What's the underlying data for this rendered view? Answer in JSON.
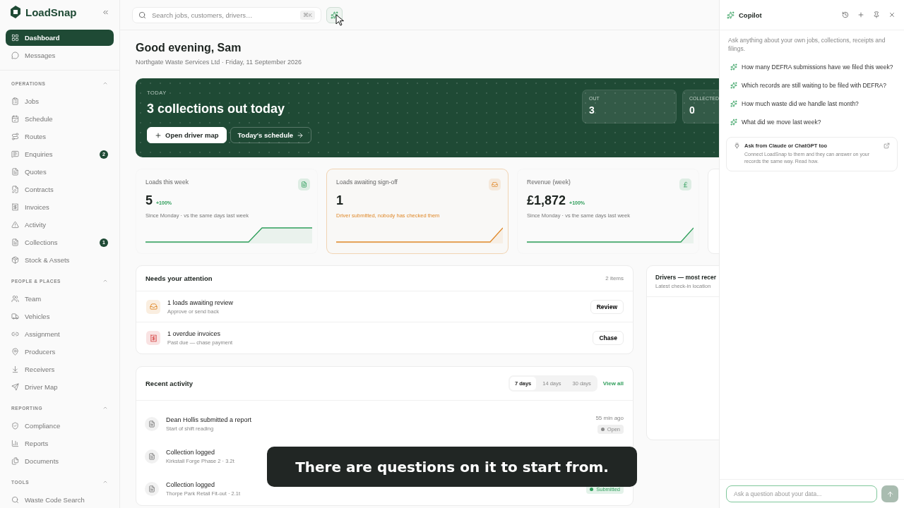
{
  "sidebar": {
    "brand": "LoadSnap",
    "top_items": [
      {
        "label": "Dashboard",
        "selected": true
      },
      {
        "label": "Messages",
        "selected": false
      }
    ],
    "sections": [
      {
        "title": "OPERATIONS",
        "expanded": true,
        "items": [
          {
            "label": "Jobs",
            "selected": false
          },
          {
            "label": "Schedule",
            "selected": false
          },
          {
            "label": "Routes",
            "selected": false
          },
          {
            "label": "Enquiries",
            "selected": false,
            "badge": "2"
          },
          {
            "label": "Quotes",
            "selected": false
          },
          {
            "label": "Contracts",
            "selected": false
          },
          {
            "label": "Invoices",
            "selected": false
          },
          {
            "label": "Activity",
            "selected": false
          },
          {
            "label": "Collections",
            "selected": false,
            "badge": "1"
          },
          {
            "label": "Stock & Assets",
            "selected": false
          }
        ]
      },
      {
        "title": "PEOPLE & PLACES",
        "expanded": true,
        "items": [
          {
            "label": "Team",
            "selected": false
          },
          {
            "label": "Vehicles",
            "selected": false
          },
          {
            "label": "Assignment",
            "selected": false
          },
          {
            "label": "Producers",
            "selected": false
          },
          {
            "label": "Receivers",
            "selected": false
          },
          {
            "label": "Driver Map",
            "selected": false
          }
        ]
      },
      {
        "title": "REPORTING",
        "expanded": true,
        "items": [
          {
            "label": "Compliance",
            "selected": false
          },
          {
            "label": "Reports",
            "selected": false
          },
          {
            "label": "Documents",
            "selected": false
          }
        ]
      },
      {
        "title": "TOOLS",
        "expanded": true,
        "items": [
          {
            "label": "Waste Code Search",
            "selected": false
          }
        ]
      }
    ]
  },
  "topbar": {
    "search": {
      "placeholder": "Search jobs, customers, drivers…"
    },
    "shortcut": "⌘K"
  },
  "greeting": {
    "title": "Good evening, Sam",
    "subtitle": "Northgate Waste Services Ltd · Friday, 11 September 2026"
  },
  "hero": {
    "label": "TODAY",
    "title": "3 collections out today",
    "buttons": [
      {
        "label": "Open driver map",
        "kind": "primary"
      },
      {
        "label": "Today's schedule",
        "kind": "outline"
      }
    ],
    "stats": [
      {
        "label": "OUT",
        "value": "3"
      },
      {
        "label": "COLLECTED",
        "value": "0"
      }
    ]
  },
  "kpis": [
    {
      "title": "Loads this week",
      "value": "5",
      "change": "+100%",
      "note": "Since Monday · vs the same days last week",
      "color": "#2f9e5b"
    },
    {
      "title": "Loads awaiting sign-off",
      "value": "1",
      "note": "Driver submitted, nobody has checked them",
      "color": "#e08a2c"
    },
    {
      "title": "Revenue (week)",
      "value": "£1,872",
      "change": "+100%",
      "note": "Since Monday · vs the same days last week",
      "color": "#2f9e5b"
    }
  ],
  "attention": {
    "title": "Needs your attention",
    "count": "2 items",
    "rows": [
      {
        "title": "1 loads awaiting review",
        "subtitle": "Approve or send back",
        "action": "Review",
        "kind": "review"
      },
      {
        "title": "1 overdue invoices",
        "subtitle": "Past due — chase payment",
        "action": "Chase",
        "kind": "invoice"
      }
    ]
  },
  "activity": {
    "title": "Recent activity",
    "ranges": [
      {
        "label": "7 days",
        "selected": true
      },
      {
        "label": "14 days",
        "selected": false
      },
      {
        "label": "30 days",
        "selected": false
      }
    ],
    "link": "View all",
    "rows": [
      {
        "title": "Dean Hollis submitted a report",
        "subtitle": "Start of shift reading",
        "time": "55 min ago",
        "status": "Open",
        "color": "#8a8a8a"
      },
      {
        "title": "Collection logged",
        "subtitle": "Kirkstall Forge Phase 2 · 3.2t"
      },
      {
        "title": "Collection logged",
        "subtitle": "Thorpe Park Retail Fit-out · 2.1t",
        "status": "Submitted",
        "color": "#2f9e5b"
      }
    ]
  },
  "drivers": {
    "title": "Drivers — most recer",
    "subtitle": "Latest check-in location"
  },
  "copilot": {
    "title": "Copilot",
    "intro": "Ask anything about your own jobs, collections, receipts and filings.",
    "suggestions": [
      "How many DEFRA submissions have we filed this week?",
      "Which records are still waiting to be filed with DEFRA?",
      "How much waste did we handle last month?",
      "What did we move last week?"
    ],
    "connect": {
      "title": "Ask from Claude or ChatGPT too",
      "text": "Connect LoadSnap to them and they can answer on your records the same way. Read how."
    },
    "input": {
      "placeholder": "Ask a question about your data..."
    }
  },
  "caption": "There are questions on it to start from."
}
